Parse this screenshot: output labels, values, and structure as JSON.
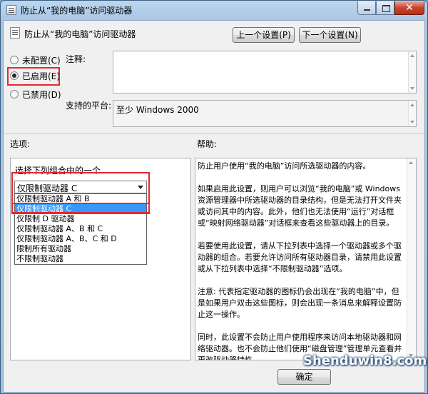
{
  "window": {
    "title": "防止从“我的电脑”访问驱动器",
    "close_glyph": "✕"
  },
  "policy": {
    "title": "防止从“我的电脑”访问驱动器"
  },
  "nav": {
    "prev_label": "上一个设置(P)",
    "next_label": "下一个设置(N)"
  },
  "state": {
    "options": [
      {
        "label": "未配置(C)",
        "checked": false
      },
      {
        "label": "已启用(E)",
        "checked": true
      },
      {
        "label": "已禁用(D)",
        "checked": false
      }
    ]
  },
  "comment": {
    "label": "注释:",
    "value": ""
  },
  "platform": {
    "label": "支持的平台:",
    "value": "至少 Windows 2000"
  },
  "sections": {
    "options_label": "选项:",
    "help_label": "帮助:"
  },
  "options_panel": {
    "prompt": "选择下列组合中的一个",
    "selected": "仅限制驱动器 C",
    "dropdown_items": [
      "仅限制驱动器 A 和 B",
      "仅限制驱动器 C",
      "仅限制 D 驱动器",
      "仅限制驱动器 A、B 和 C",
      "仅限制驱动器 A、B、C 和 D",
      "限制所有驱动器",
      "不限制驱动器"
    ],
    "highlighted_index": 1
  },
  "help": {
    "paragraphs": [
      "防止用户使用“我的电脑”访问所选驱动器的内容。",
      "如果启用此设置，则用户可以浏览“我的电脑”或 Windows 资源管理器中所选驱动器的目录结构，但是无法打开文件夹或访问其中的内容。此外，他们也无法使用“运行”对话框或“映射网络驱动器”对话框来查看这些驱动器上的目录。",
      "若要使用此设置，请从下拉列表中选择一个驱动器或多个驱动器的组合。若要允许访问所有驱动器目录，请禁用此设置或从下拉列表中选择“不限制驱动器”选项。",
      "注意: 代表指定驱动器的图标仍会出现在“我的电脑”中，但是如果用户双击这些图标，则会出现一条消息来解释设置防止这一操作。",
      "同时，此设置不会防止用户使用程序来访问本地驱动器和网络驱动器。也不会防止他们使用“磁盘管理”管理单元查看并更改驱动器特性。"
    ]
  },
  "footer": {
    "ok_label": "确定"
  },
  "watermark": {
    "text": "Shenduwin8.com"
  },
  "colors": {
    "highlight_border": "#e8262f",
    "selection_bg": "#3399ff"
  }
}
